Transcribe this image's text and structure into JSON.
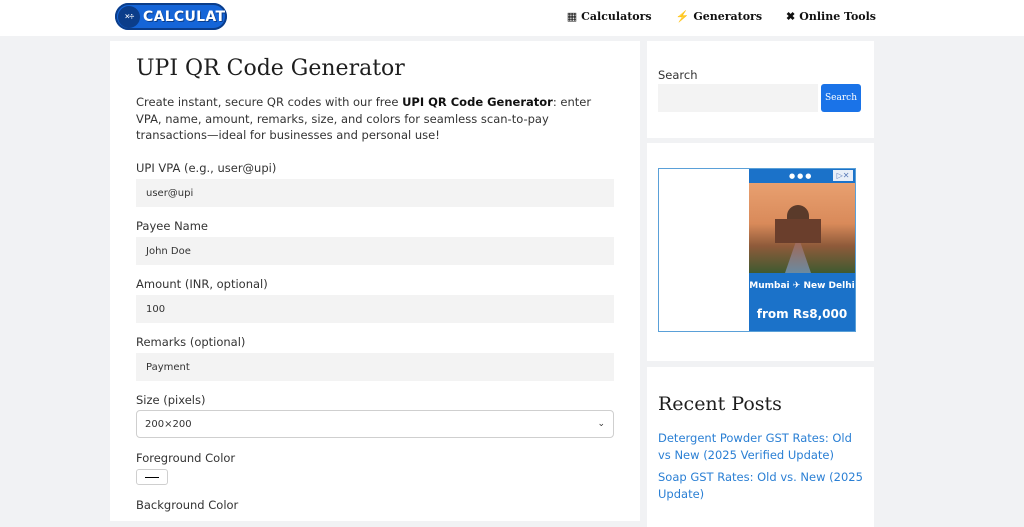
{
  "header": {
    "logo_text": "CALCULAT",
    "logo_badge": "×÷",
    "nav": [
      {
        "label": "Calculators",
        "icon": "calculator-icon"
      },
      {
        "label": "Generators",
        "icon": "bolt-icon"
      },
      {
        "label": "Online Tools",
        "icon": "tools-icon"
      }
    ]
  },
  "main": {
    "title": "UPI QR Code Generator",
    "intro_pre": "Create instant, secure QR codes with our free ",
    "intro_bold": "UPI QR Code Generator",
    "intro_post": ": enter VPA, name, amount, remarks, size, and colors for seamless scan-to-pay transactions—ideal for businesses and personal use!",
    "fields": {
      "vpa_label": "UPI VPA (e.g., user@upi)",
      "vpa_value": "user@upi",
      "name_label": "Payee Name",
      "name_value": "John Doe",
      "amount_label": "Amount (INR, optional)",
      "amount_value": "100",
      "remarks_label": "Remarks (optional)",
      "remarks_value": "Payment",
      "size_label": "Size (pixels)",
      "size_value": "200×200",
      "fg_label": "Foreground Color",
      "fg_value": "#000000",
      "bg_label": "Background Color"
    }
  },
  "sidebar": {
    "search_label": "Search",
    "search_button": "Search",
    "ad": {
      "route": "Mumbai ✈ New Delhi",
      "price": "from Rs8,000"
    },
    "recent_posts_title": "Recent Posts",
    "recent_posts": [
      "Detergent Powder GST Rates: Old vs New (2025 Verified Update)",
      "Soap GST Rates: Old vs. New (2025 Update)"
    ]
  }
}
